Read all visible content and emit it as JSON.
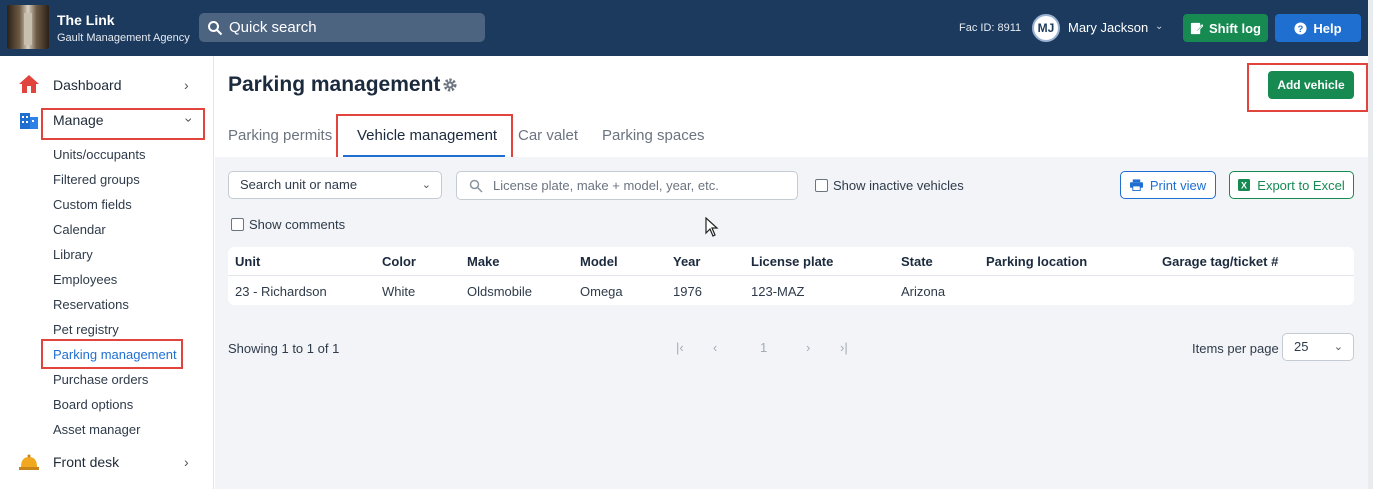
{
  "header": {
    "brand_title": "The Link",
    "brand_subtitle": "Gault Management Agency",
    "quick_search_label": "Quick search",
    "fac_id": "Fac ID: 8911",
    "user_initials": "MJ",
    "user_name": "Mary Jackson",
    "shift_log_label": "Shift log",
    "help_label": "Help"
  },
  "sidebar": {
    "dashboard": "Dashboard",
    "manage": "Manage",
    "sub_items": [
      "Units/occupants",
      "Filtered groups",
      "Custom fields",
      "Calendar",
      "Library",
      "Employees",
      "Reservations",
      "Pet registry",
      "Parking management",
      "Purchase orders",
      "Board options",
      "Asset manager"
    ],
    "front_desk": "Front desk"
  },
  "main": {
    "title": "Parking management",
    "add_vehicle_label": "Add vehicle",
    "tabs": [
      "Parking permits",
      "Vehicle management",
      "Car valet",
      "Parking spaces"
    ],
    "active_tab": "Vehicle management",
    "filter_select": "Search unit or name",
    "search_placeholder": "License plate, make + model, year, etc.",
    "show_inactive_label": "Show inactive vehicles",
    "show_comments_label": "Show comments",
    "print_view_label": "Print view",
    "export_label": "Export to Excel"
  },
  "table": {
    "columns": [
      "Unit",
      "Color",
      "Make",
      "Model",
      "Year",
      "License plate",
      "State",
      "Parking location",
      "Garage tag/ticket #"
    ],
    "rows": [
      [
        "23 - Richardson",
        "White",
        "Oldsmobile",
        "Omega",
        "1976",
        "123-MAZ",
        "Arizona",
        "",
        ""
      ]
    ]
  },
  "pagination": {
    "showing": "Showing 1 to 1 of 1",
    "current_page": "1",
    "items_per_page_label": "Items per page",
    "items_per_page": "25"
  },
  "colors": {
    "header_bg": "#1b3a5e",
    "accent_green": "#178a52",
    "accent_blue": "#1f6fd1",
    "highlight_red": "#e0443c"
  }
}
